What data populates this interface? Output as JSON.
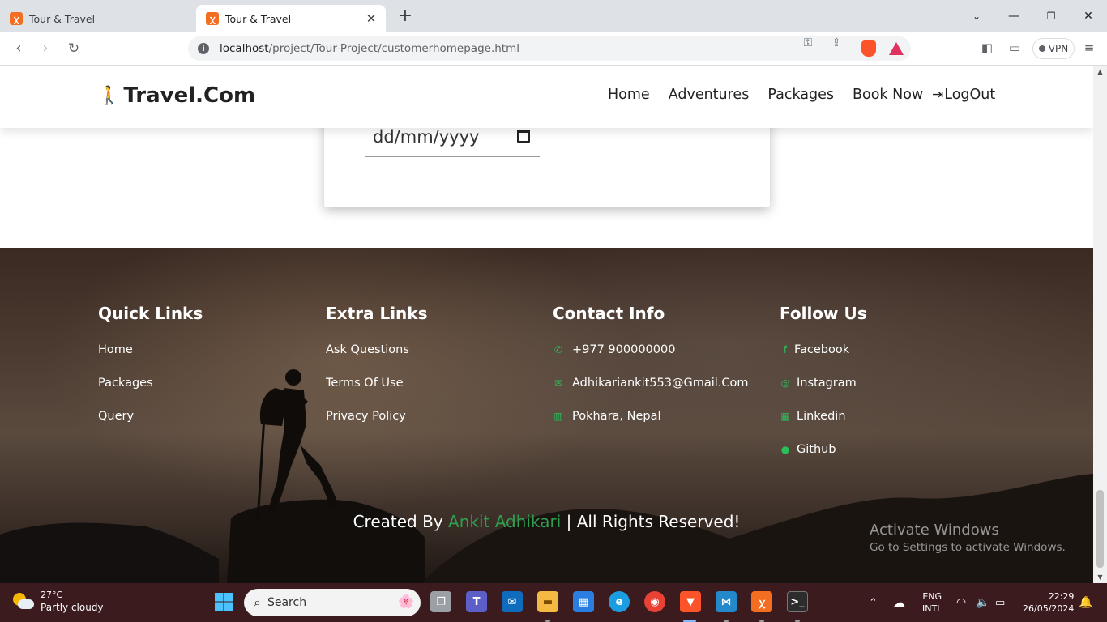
{
  "browser": {
    "tabs": [
      {
        "title": "Tour & Travel",
        "active": false
      },
      {
        "title": "Tour & Travel",
        "active": true
      }
    ],
    "url_host": "localhost",
    "url_path": "/project/Tour-Project/customerhomepage.html",
    "vpn_label": "VPN"
  },
  "site": {
    "brand": "Travel.Com",
    "nav": [
      "Home",
      "Adventures",
      "Packages",
      "Book Now"
    ],
    "logout": "LogOut",
    "date_placeholder": "dd/mm/yyyy"
  },
  "footer": {
    "quick_links": {
      "title": "Quick Links",
      "items": [
        "Home",
        "Packages",
        "Query"
      ]
    },
    "extra_links": {
      "title": "Extra Links",
      "items": [
        "Ask Questions",
        "Terms Of Use",
        "Privacy Policy"
      ]
    },
    "contact": {
      "title": "Contact Info",
      "items": [
        {
          "icon": "phone-icon",
          "text": "+977 900000000"
        },
        {
          "icon": "envelope-icon",
          "text": "Adhikariankit553@Gmail.Com"
        },
        {
          "icon": "map-icon",
          "text": "Pokhara, Nepal"
        }
      ]
    },
    "follow": {
      "title": "Follow Us",
      "items": [
        {
          "icon": "facebook-icon",
          "text": "Facebook"
        },
        {
          "icon": "instagram-icon",
          "text": "Instagram"
        },
        {
          "icon": "linkedin-icon",
          "text": "Linkedin"
        },
        {
          "icon": "github-icon",
          "text": "Github"
        }
      ]
    },
    "credit_prefix": "Created By",
    "credit_name": "Ankit Adhikari",
    "credit_suffix": "| All Rights Reserved!",
    "accent": "#2f9e4f"
  },
  "watermark": {
    "line1": "Activate Windows",
    "line2": "Go to Settings to activate Windows."
  },
  "taskbar": {
    "weather_temp": "27°C",
    "weather_desc": "Partly cloudy",
    "search_placeholder": "Search",
    "lang1": "ENG",
    "lang2": "INTL",
    "time": "22:29",
    "date": "26/05/2024"
  }
}
